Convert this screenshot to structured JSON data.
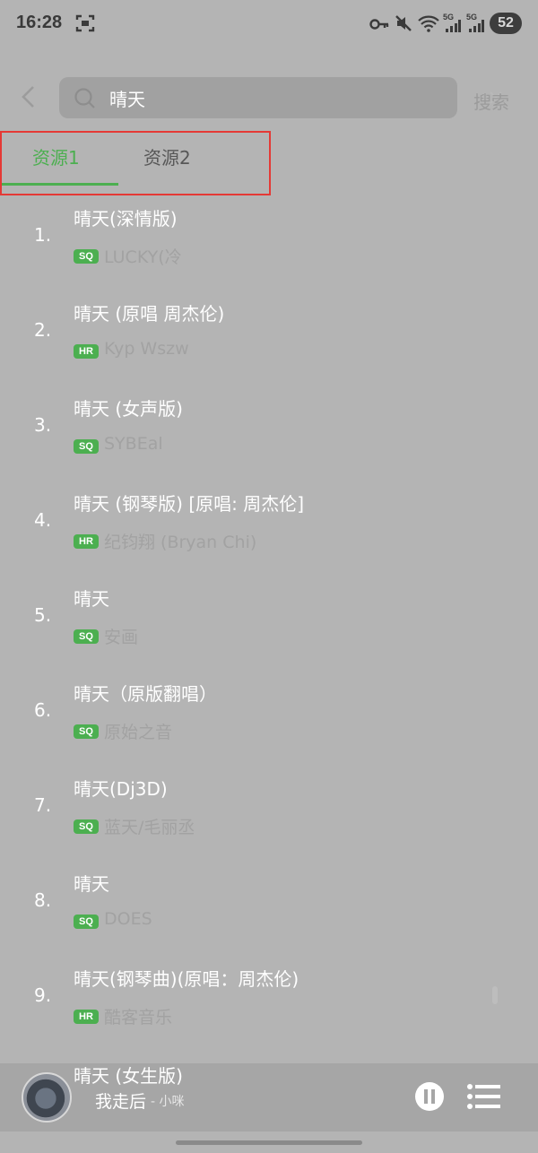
{
  "status_bar": {
    "time": "16:28",
    "network_1": "5G",
    "network_2": "5G",
    "battery": "52"
  },
  "search": {
    "query": "晴天",
    "button_label": "搜索"
  },
  "tabs": [
    {
      "label": "资源1",
      "active": true
    },
    {
      "label": "资源2",
      "active": false
    }
  ],
  "results": [
    {
      "num": "1.",
      "title": "晴天(深情版)",
      "quality": "SQ",
      "artist": "LUCKY(冷"
    },
    {
      "num": "2.",
      "title": "晴天 (原唱 周杰伦)",
      "quality": "HR",
      "artist": "Kyp Wszw"
    },
    {
      "num": "3.",
      "title": "晴天 (女声版)",
      "quality": "SQ",
      "artist": "SYBEal"
    },
    {
      "num": "4.",
      "title": "晴天 (钢琴版) [原唱: 周杰伦]",
      "quality": "HR",
      "artist": "纪钧翔 (Bryan Chi)"
    },
    {
      "num": "5.",
      "title": "晴天",
      "quality": "SQ",
      "artist": "安画"
    },
    {
      "num": "6.",
      "title": "晴天（原版翻唱）",
      "quality": "SQ",
      "artist": "原始之音"
    },
    {
      "num": "7.",
      "title": "晴天(Dj3D)",
      "quality": "SQ",
      "artist": "蓝天/毛丽丞"
    },
    {
      "num": "8.",
      "title": "晴天",
      "quality": "SQ",
      "artist": "DOES"
    },
    {
      "num": "9.",
      "title": "晴天(钢琴曲)(原唱：周杰伦)",
      "quality": "HR",
      "artist": "酷客音乐"
    }
  ],
  "next_result_title": "晴天 (女生版)",
  "player": {
    "song": "我走后",
    "artist": "- 小咪"
  },
  "colors": {
    "accent": "#4caf50",
    "highlight_box": "#e53935",
    "overlay_bg": "#b4b4b4"
  }
}
